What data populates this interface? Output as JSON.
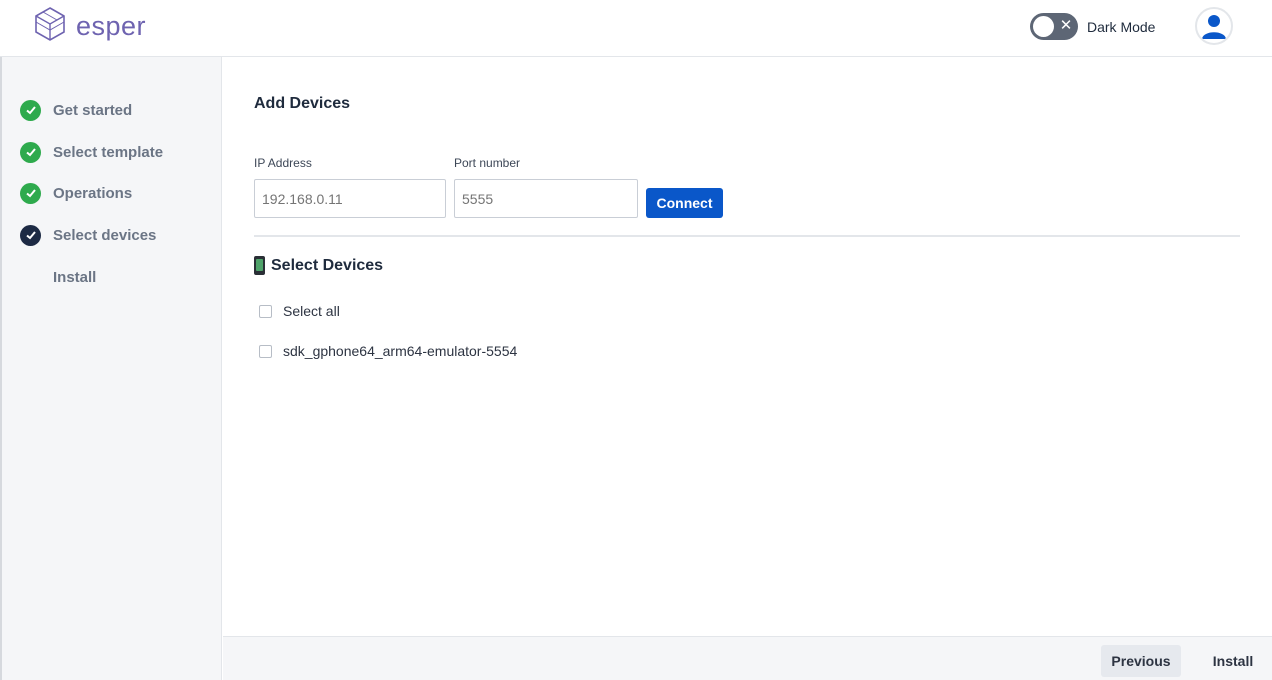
{
  "header": {
    "logo_text": "esper",
    "logo_icon": "esper-cube-logo-icon",
    "dark_mode_label": "Dark Mode",
    "dark_mode_on": false,
    "avatar_icon": "user-avatar-icon"
  },
  "sidebar": {
    "steps": [
      {
        "label": "Get started",
        "status": "done"
      },
      {
        "label": "Select template",
        "status": "done"
      },
      {
        "label": "Operations",
        "status": "done"
      },
      {
        "label": "Select devices",
        "status": "current"
      },
      {
        "label": "Install",
        "status": "pending"
      }
    ]
  },
  "main": {
    "add_title": "Add Devices",
    "ip_label": "IP Address",
    "ip_placeholder": "192.168.0.11",
    "port_label": "Port number",
    "port_placeholder": "5555",
    "connect_label": "Connect",
    "select_title": "Select Devices",
    "select_all_label": "Select all",
    "devices": [
      "sdk_gphone64_arm64-emulator-5554"
    ]
  },
  "footer": {
    "previous_label": "Previous",
    "install_label": "Install"
  },
  "colors": {
    "accent": "#0a57c9",
    "done": "#2eaa4d",
    "current": "#1d2a44",
    "logo": "#6e63b0"
  }
}
